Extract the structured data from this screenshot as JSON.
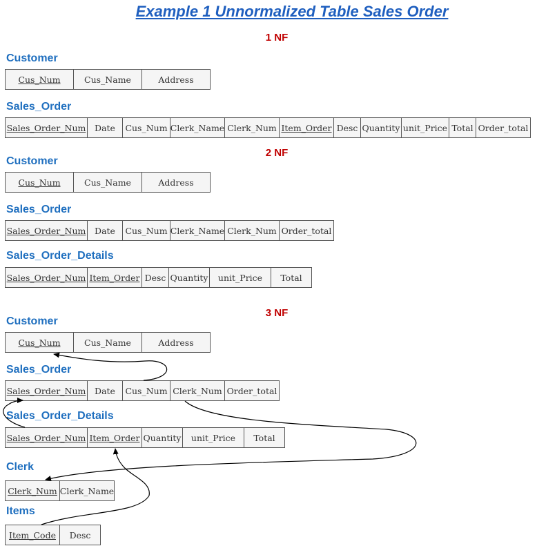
{
  "title": "Example 1 Unnormalized Table Sales Order",
  "nf1": {
    "heading": "1 NF",
    "customer": {
      "name": "Customer",
      "cols": [
        {
          "label": "Cus_Num",
          "key": true
        },
        {
          "label": "Cus_Name",
          "key": false
        },
        {
          "label": "Address",
          "key": false
        }
      ]
    },
    "sales_order": {
      "name": "Sales_Order",
      "cols": [
        {
          "label": "Sales_Order_Num",
          "key": true
        },
        {
          "label": "Date",
          "key": false
        },
        {
          "label": "Cus_Num",
          "key": false
        },
        {
          "label": "Clerk_Name",
          "key": false
        },
        {
          "label": "Clerk_Num",
          "key": false
        },
        {
          "label": "Item_Order",
          "key": true
        },
        {
          "label": "Desc",
          "key": false
        },
        {
          "label": "Quantity",
          "key": false
        },
        {
          "label": "unit_Price",
          "key": false
        },
        {
          "label": "Total",
          "key": false
        },
        {
          "label": "Order_total",
          "key": false
        }
      ]
    }
  },
  "nf2": {
    "heading": "2 NF",
    "customer": {
      "name": "Customer",
      "cols": [
        {
          "label": "Cus_Num",
          "key": true
        },
        {
          "label": "Cus_Name",
          "key": false
        },
        {
          "label": "Address",
          "key": false
        }
      ]
    },
    "sales_order": {
      "name": "Sales_Order",
      "cols": [
        {
          "label": "Sales_Order_Num",
          "key": true
        },
        {
          "label": "Date",
          "key": false
        },
        {
          "label": "Cus_Num",
          "key": false
        },
        {
          "label": "Clerk_Name",
          "key": false
        },
        {
          "label": "Clerk_Num",
          "key": false
        },
        {
          "label": "Order_total",
          "key": false
        }
      ]
    },
    "sales_order_details": {
      "name": "Sales_Order_Details",
      "cols": [
        {
          "label": "Sales_Order_Num",
          "key": true
        },
        {
          "label": "Item_Order",
          "key": true
        },
        {
          "label": "Desc",
          "key": false
        },
        {
          "label": "Quantity",
          "key": false
        },
        {
          "label": "unit_Price",
          "key": false
        },
        {
          "label": "Total",
          "key": false
        }
      ]
    }
  },
  "nf3": {
    "heading": "3 NF",
    "customer": {
      "name": "Customer",
      "cols": [
        {
          "label": "Cus_Num",
          "key": true
        },
        {
          "label": "Cus_Name",
          "key": false
        },
        {
          "label": "Address",
          "key": false
        }
      ]
    },
    "sales_order": {
      "name": "Sales_Order",
      "cols": [
        {
          "label": "Sales_Order_Num",
          "key": true
        },
        {
          "label": "Date",
          "key": false
        },
        {
          "label": "Cus_Num",
          "key": false
        },
        {
          "label": "Clerk_Num",
          "key": false
        },
        {
          "label": "Order_total",
          "key": false
        }
      ]
    },
    "sales_order_details": {
      "name": "Sales_Order_Details",
      "cols": [
        {
          "label": "Sales_Order_Num",
          "key": true
        },
        {
          "label": "Item_Order",
          "key": true
        },
        {
          "label": "Quantity",
          "key": false
        },
        {
          "label": "unit_Price",
          "key": false
        },
        {
          "label": "Total",
          "key": false
        }
      ]
    },
    "clerk": {
      "name": "Clerk",
      "cols": [
        {
          "label": "Clerk_Num",
          "key": true
        },
        {
          "label": "Clerk_Name",
          "key": false
        }
      ]
    },
    "items": {
      "name": "Items",
      "cols": [
        {
          "label": "Item_Code",
          "key": true
        },
        {
          "label": "Desc",
          "key": false
        }
      ]
    }
  },
  "colors": {
    "title": "#1f5fbf",
    "nf_heading": "#c00000",
    "table_name": "#1f6fbf",
    "cell_fill": "#f5f5f5",
    "cell_border": "#555555"
  }
}
